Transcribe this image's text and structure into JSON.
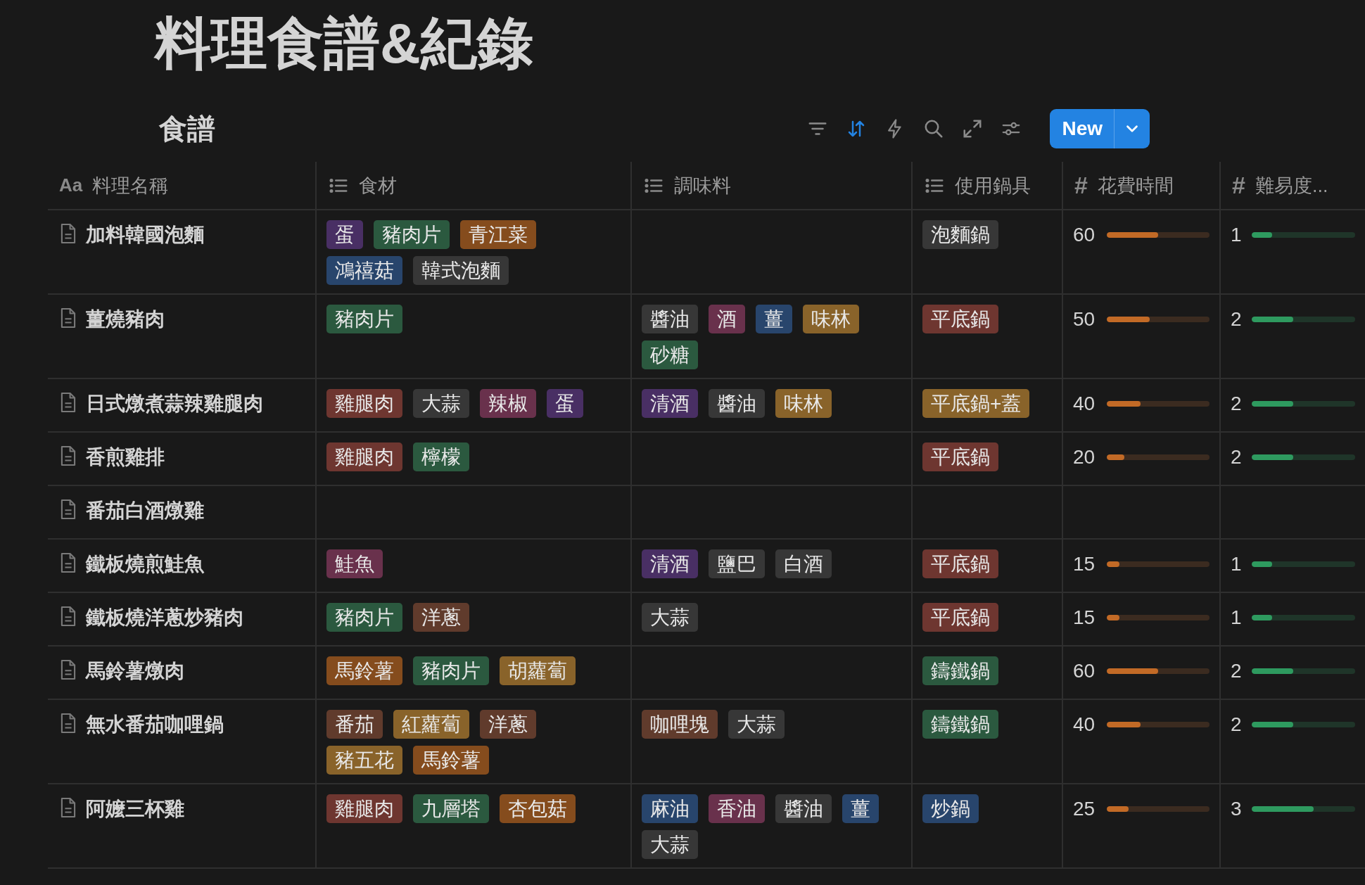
{
  "page": {
    "title": "料理食譜&紀錄"
  },
  "view": {
    "title": "食譜"
  },
  "toolbar": [
    {
      "kind": "filter",
      "active": false
    },
    {
      "kind": "sort",
      "active": true
    },
    {
      "kind": "automation",
      "active": false
    },
    {
      "kind": "search",
      "active": false
    },
    {
      "kind": "expand",
      "active": false
    },
    {
      "kind": "settings",
      "active": false
    }
  ],
  "new_button": {
    "label": "New"
  },
  "columns": [
    {
      "kind": "title",
      "glyph": "Aa",
      "label": "料理名稱"
    },
    {
      "kind": "list",
      "label": "食材"
    },
    {
      "kind": "list",
      "label": "調味料"
    },
    {
      "kind": "list",
      "label": "使用鍋具"
    },
    {
      "kind": "number",
      "glyph": "#",
      "label": "花費時間"
    },
    {
      "kind": "number",
      "glyph": "#",
      "label": "難易度..."
    }
  ],
  "rows": [
    {
      "name": "加料韓國泡麵",
      "ingredients": [
        {
          "label": "蛋",
          "color": "#492f64"
        },
        {
          "label": "豬肉片",
          "color": "#2b593f"
        },
        {
          "label": "青江菜",
          "color": "#854c1d"
        },
        {
          "label": "鴻禧菇",
          "color": "#28456c"
        },
        {
          "label": "韓式泡麵",
          "color": "#373737"
        }
      ],
      "seasonings": [],
      "cookware": [
        {
          "label": "泡麵鍋",
          "color": "#373737"
        }
      ],
      "time": {
        "value": "60",
        "level": 0.5
      },
      "difficulty": {
        "value": "1",
        "level": 0.2
      }
    },
    {
      "name": "薑燒豬肉",
      "ingredients": [
        {
          "label": "豬肉片",
          "color": "#2b593f"
        }
      ],
      "seasonings": [
        {
          "label": "醬油",
          "color": "#373737"
        },
        {
          "label": "酒",
          "color": "#69314c"
        },
        {
          "label": "薑",
          "color": "#28456c"
        },
        {
          "label": "味林",
          "color": "#89632a"
        },
        {
          "label": "砂糖",
          "color": "#2b593f"
        }
      ],
      "cookware": [
        {
          "label": "平底鍋",
          "color": "#6e3630"
        }
      ],
      "time": {
        "value": "50",
        "level": 0.42
      },
      "difficulty": {
        "value": "2",
        "level": 0.4
      }
    },
    {
      "name": "日式燉煮蒜辣雞腿肉",
      "ingredients": [
        {
          "label": "雞腿肉",
          "color": "#6e3630"
        },
        {
          "label": "大蒜",
          "color": "#373737"
        },
        {
          "label": "辣椒",
          "color": "#69314c"
        },
        {
          "label": "蛋",
          "color": "#492f64"
        }
      ],
      "seasonings": [
        {
          "label": "清酒",
          "color": "#492f64"
        },
        {
          "label": "醬油",
          "color": "#373737"
        },
        {
          "label": "味林",
          "color": "#89632a"
        }
      ],
      "cookware": [
        {
          "label": "平底鍋+蓋",
          "color": "#89632a"
        }
      ],
      "time": {
        "value": "40",
        "level": 0.33
      },
      "difficulty": {
        "value": "2",
        "level": 0.4
      }
    },
    {
      "name": "香煎雞排",
      "ingredients": [
        {
          "label": "雞腿肉",
          "color": "#6e3630"
        },
        {
          "label": "檸檬",
          "color": "#2b593f"
        }
      ],
      "seasonings": [],
      "cookware": [
        {
          "label": "平底鍋",
          "color": "#6e3630"
        }
      ],
      "time": {
        "value": "20",
        "level": 0.17
      },
      "difficulty": {
        "value": "2",
        "level": 0.4
      }
    },
    {
      "name": "番茄白酒燉雞",
      "ingredients": [],
      "seasonings": [],
      "cookware": []
    },
    {
      "name": "鐵板燒煎鮭魚",
      "ingredients": [
        {
          "label": "鮭魚",
          "color": "#69314c"
        }
      ],
      "seasonings": [
        {
          "label": "清酒",
          "color": "#492f64"
        },
        {
          "label": "鹽巴",
          "color": "#373737"
        },
        {
          "label": "白酒",
          "color": "#373737"
        }
      ],
      "cookware": [
        {
          "label": "平底鍋",
          "color": "#6e3630"
        }
      ],
      "time": {
        "value": "15",
        "level": 0.125
      },
      "difficulty": {
        "value": "1",
        "level": 0.2
      }
    },
    {
      "name": "鐵板燒洋蔥炒豬肉",
      "ingredients": [
        {
          "label": "豬肉片",
          "color": "#2b593f"
        },
        {
          "label": "洋蔥",
          "color": "#603b2c"
        }
      ],
      "seasonings": [
        {
          "label": "大蒜",
          "color": "#373737"
        }
      ],
      "cookware": [
        {
          "label": "平底鍋",
          "color": "#6e3630"
        }
      ],
      "time": {
        "value": "15",
        "level": 0.125
      },
      "difficulty": {
        "value": "1",
        "level": 0.2
      }
    },
    {
      "name": "馬鈴薯燉肉",
      "ingredients": [
        {
          "label": "馬鈴薯",
          "color": "#854c1d"
        },
        {
          "label": "豬肉片",
          "color": "#2b593f"
        },
        {
          "label": "胡蘿蔔",
          "color": "#89632a"
        }
      ],
      "seasonings": [],
      "cookware": [
        {
          "label": "鑄鐵鍋",
          "color": "#2b593f"
        }
      ],
      "time": {
        "value": "60",
        "level": 0.5
      },
      "difficulty": {
        "value": "2",
        "level": 0.4
      }
    },
    {
      "name": "無水番茄咖哩鍋",
      "ingredients": [
        {
          "label": "番茄",
          "color": "#603b2c"
        },
        {
          "label": "紅蘿蔔",
          "color": "#89632a"
        },
        {
          "label": "洋蔥",
          "color": "#603b2c"
        },
        {
          "label": "豬五花",
          "color": "#89632a"
        },
        {
          "label": "馬鈴薯",
          "color": "#854c1d"
        }
      ],
      "seasonings": [
        {
          "label": "咖哩塊",
          "color": "#603b2c"
        },
        {
          "label": "大蒜",
          "color": "#373737"
        }
      ],
      "cookware": [
        {
          "label": "鑄鐵鍋",
          "color": "#2b593f"
        }
      ],
      "time": {
        "value": "40",
        "level": 0.33
      },
      "difficulty": {
        "value": "2",
        "level": 0.4
      }
    },
    {
      "name": "阿嬤三杯雞",
      "ingredients": [
        {
          "label": "雞腿肉",
          "color": "#6e3630"
        },
        {
          "label": "九層塔",
          "color": "#2b593f"
        },
        {
          "label": "杏包菇",
          "color": "#854c1d"
        }
      ],
      "seasonings": [
        {
          "label": "麻油",
          "color": "#28456c"
        },
        {
          "label": "香油",
          "color": "#69314c"
        },
        {
          "label": "醬油",
          "color": "#373737"
        },
        {
          "label": "薑",
          "color": "#28456c"
        },
        {
          "label": "大蒜",
          "color": "#373737"
        }
      ],
      "cookware": [
        {
          "label": "炒鍋",
          "color": "#28456c"
        }
      ],
      "time": {
        "value": "25",
        "level": 0.21
      },
      "difficulty": {
        "value": "3",
        "level": 0.6
      }
    }
  ]
}
